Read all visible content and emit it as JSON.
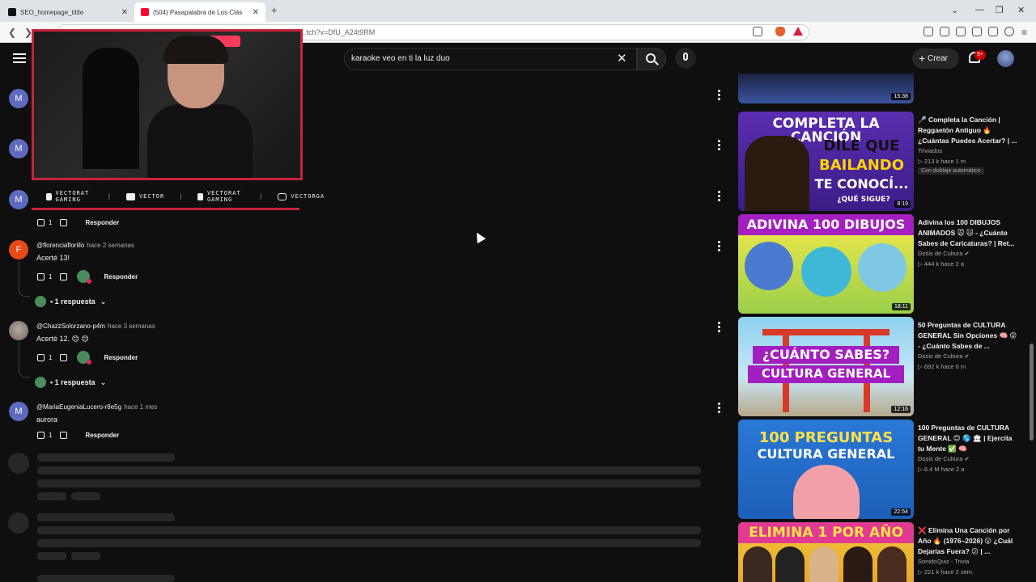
{
  "browser": {
    "tabs": [
      {
        "title": "SEO_homepage_tittle"
      },
      {
        "title": "(504) Pasapalabra de Los Clás"
      }
    ],
    "new_tab": "+",
    "url": "...tch?v=DfU_A24t9RM"
  },
  "header": {
    "search_value": "karaoke veo en ti la luz duo",
    "create_label": "Crear",
    "notif_badge": "9+"
  },
  "overlay": {
    "social": [
      "VECTORAT GAMING",
      "VECTOR",
      "VECTORAT GAMING",
      "VECTORGA"
    ]
  },
  "comments": [
    {
      "avatar_letter": "M",
      "avatar_color": "#5c6bc0",
      "likes": "1",
      "reply": "Responder"
    },
    {
      "avatar_letter": "M",
      "avatar_color": "#5c6bc0"
    },
    {
      "avatar_letter": "M",
      "avatar_color": "#5c6bc0"
    },
    {
      "avatar_letter": "F",
      "avatar_color": "#e64a19",
      "author": "@florenciaflorillo",
      "when": "hace 2 semanas",
      "text": "Acerté  13!",
      "likes": "1",
      "reply": "Responder",
      "replies": "• 1 respuesta"
    },
    {
      "avatar_letter": "",
      "avatar_color": "#7a6f6a",
      "author": "@ChazzSolorzano-p4m",
      "when": "hace 3 semanas",
      "text": "Acerté 12. 😊 😊",
      "likes": "1",
      "reply": "Responder",
      "replies": "• 1 respuesta"
    },
    {
      "avatar_letter": "M",
      "avatar_color": "#5c6bc0",
      "author": "@MariaEugeniaLucero-r8e5g",
      "when": "hace 1 mes",
      "text": "aurora",
      "likes": "1",
      "reply": "Responder"
    }
  ],
  "videos": [
    {
      "duration": "15:38"
    },
    {
      "title": "🎤 Completa la Canción | Reggaetón Antiguo 🔥 ¿Cuántas Puedes Acertar? | ...",
      "channel": "Triviados",
      "meta": "▷ 213 k  hace 1 m",
      "badge": "Con doblaje automático",
      "duration": "8:19",
      "thumb_text_1": "COMPLETA LA CANCIÓN",
      "thumb_text_2": "DILE QUE",
      "thumb_text_3": "BAILANDO",
      "thumb_text_4": "TE CONOCÍ...",
      "thumb_text_5": "¿QUÉ SIGUE?"
    },
    {
      "title": "Adivina los 100 DIBUJOS ANIMADOS 🐭 🐱 - ¿Cuánto Sabes de Caricaturas? | Ret...",
      "channel": "Dosis de Cultura ✔",
      "meta": "▷ 444 k  hace 2 a",
      "duration": "18:11",
      "thumb_text_1": "ADIVINA 100 DIBUJOS"
    },
    {
      "title": "50 Preguntas de CULTURA GENERAL Sin Opciones 🧠 😲 - ¿Cuánto Sabes de ...",
      "channel": "Dosis de Cultura ✔",
      "meta": "▷ 692 k  hace 6 m",
      "duration": "12:16",
      "thumb_text_1": "¿CUÁNTO SABES?",
      "thumb_text_2": "CULTURA GENERAL"
    },
    {
      "title": "100 Preguntas de CULTURA GENERAL 😊 🌎 🏛 | Ejercita tu Mente ✅ 🧠",
      "channel": "Dosis de Cultura ✔",
      "meta": "▷ 6.4 M  hace 2 a",
      "duration": "22:54",
      "thumb_text_1": "100 PREGUNTAS",
      "thumb_text_2": "CULTURA GENERAL"
    },
    {
      "title": "❌ Elimina Una Canción por Año 🔥 (1976–2026) 😮 ¿Cuál Dejarías Fuera? 😕 | ...",
      "channel": "SonidoQuiz - Trivia",
      "meta": "▷ 221 k  hace 2 sem.",
      "thumb_text_1": "ELIMINA 1 POR AÑO"
    }
  ],
  "colors": {
    "accent": "#c9233a",
    "bg": "#0f0f0f"
  }
}
